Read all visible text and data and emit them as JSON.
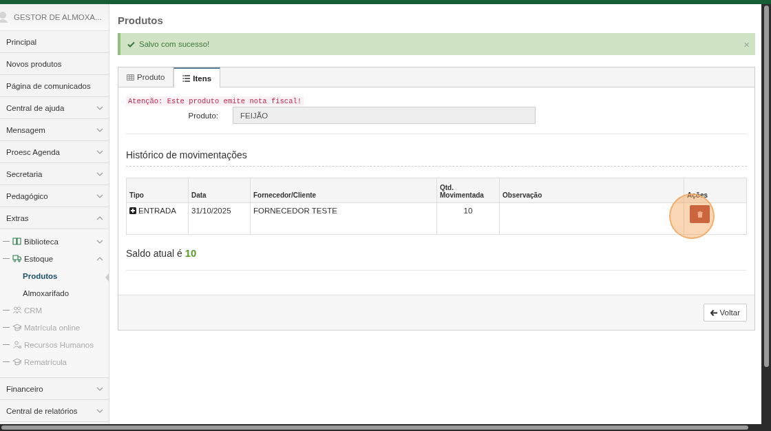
{
  "sidebar": {
    "user": "GESTOR DE ALMOXA...",
    "items": [
      {
        "label": "Principal",
        "kind": "link"
      },
      {
        "label": "Novos produtos",
        "kind": "link"
      },
      {
        "label": "Página de comunicados",
        "kind": "link"
      },
      {
        "label": "Central de ajuda",
        "kind": "group",
        "expanded": false
      },
      {
        "label": "Mensagem",
        "kind": "group",
        "expanded": false
      },
      {
        "label": "Proesc Agenda",
        "kind": "group",
        "expanded": false
      },
      {
        "label": "Secretaria",
        "kind": "group",
        "expanded": false
      },
      {
        "label": "Pedagógico",
        "kind": "group",
        "expanded": false
      },
      {
        "label": "Extras",
        "kind": "group",
        "expanded": true,
        "children": [
          {
            "label": "Biblioteca",
            "kind": "group",
            "expanded": false,
            "disabled": false
          },
          {
            "label": "Estoque",
            "kind": "group",
            "expanded": true,
            "disabled": false,
            "children": [
              {
                "label": "Produtos",
                "selected": true
              },
              {
                "label": "Almoxarifado",
                "selected": false
              }
            ]
          },
          {
            "label": "CRM",
            "kind": "link",
            "disabled": true
          },
          {
            "label": "Matrícula online",
            "kind": "link",
            "disabled": true
          },
          {
            "label": "Recursos Humanos",
            "kind": "link",
            "disabled": true
          },
          {
            "label": "Rematrícula",
            "kind": "link",
            "disabled": true
          }
        ]
      },
      {
        "label": "Financeiro",
        "kind": "group",
        "expanded": false
      },
      {
        "label": "Central de relatórios",
        "kind": "group",
        "expanded": false
      }
    ]
  },
  "page_title": "Produtos",
  "alert": {
    "message": "Salvo com sucesso!",
    "close": "×"
  },
  "tabs": [
    {
      "label": "Produto",
      "selected": false
    },
    {
      "label": "Itens",
      "selected": true
    }
  ],
  "warning": "Atenção: Este produto emite nota fiscal!",
  "product_field": {
    "label": "Produto:",
    "value": "FEIJÃO"
  },
  "history_title": "Histórico de movimentações",
  "table": {
    "columns": [
      "Tipo",
      "Data",
      "Fornecedor/Cliente",
      "Qtd. Movimentada",
      "Observação",
      "Ações"
    ],
    "rows": [
      {
        "tipo": "ENTRADA",
        "data": "31/10/2025",
        "fornecedor": "FORNECEDOR TESTE",
        "qtd": "10",
        "observacao": ""
      }
    ]
  },
  "balance": {
    "label": "Saldo atual é",
    "value": "10"
  },
  "back_button": "Voltar"
}
